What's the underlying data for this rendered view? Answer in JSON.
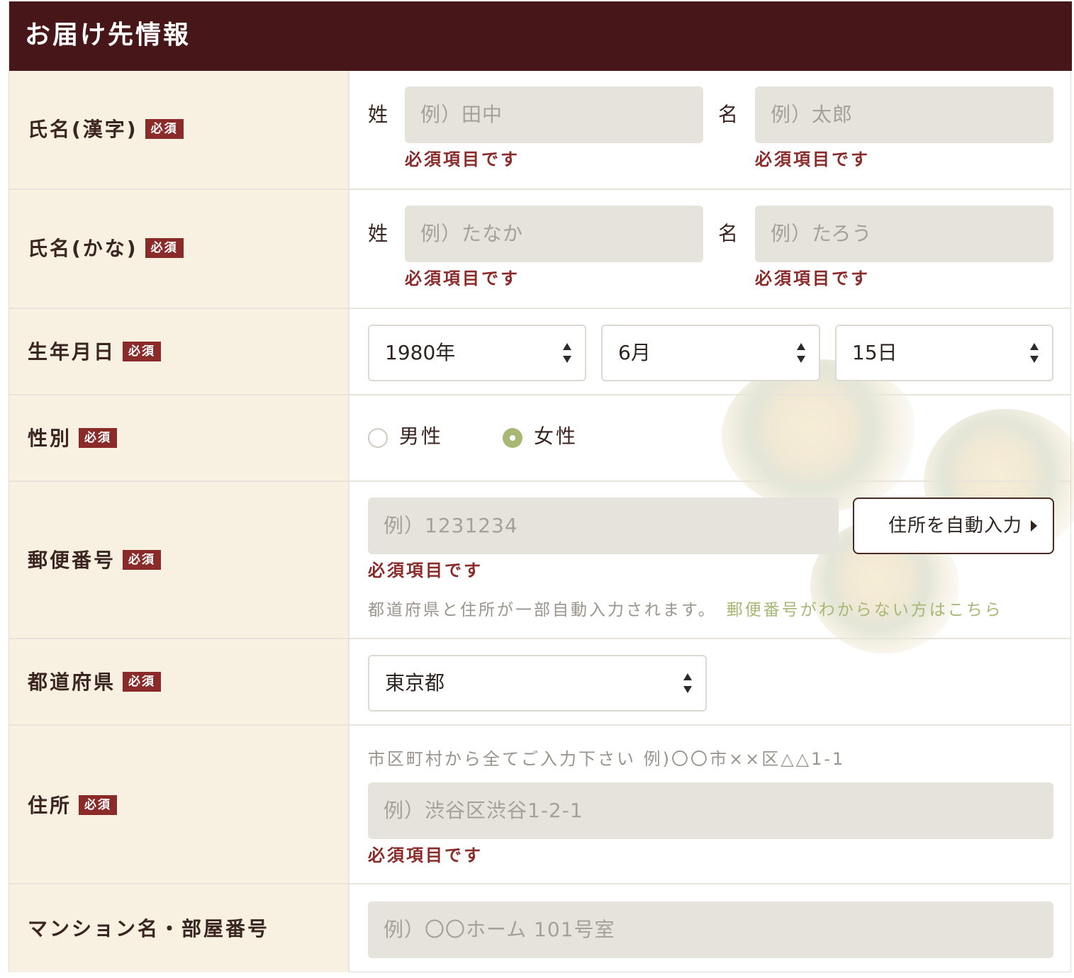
{
  "title": "お届け先情報",
  "required_badge": "必須",
  "error_text": "必須項目です",
  "name_kanji": {
    "label": "氏名(漢字)",
    "last_label": "姓",
    "first_label": "名",
    "last_placeholder": "例）田中",
    "first_placeholder": "例）太郎"
  },
  "name_kana": {
    "label": "氏名(かな)",
    "last_label": "姓",
    "first_label": "名",
    "last_placeholder": "例）たなか",
    "first_placeholder": "例）たろう"
  },
  "birthday": {
    "label": "生年月日",
    "year": "1980年",
    "month": "6月",
    "day": "15日"
  },
  "gender": {
    "label": "性別",
    "options": [
      "男性",
      "女性"
    ],
    "selected": "女性"
  },
  "postal": {
    "label": "郵便番号",
    "placeholder": "例）1231234",
    "autofill_button": "住所を自動入力",
    "note": "都道府県と住所が一部自動入力されます。",
    "link": "郵便番号がわからない方はこちら"
  },
  "prefecture": {
    "label": "都道府県",
    "value": "東京都"
  },
  "address": {
    "label": "住所",
    "hint": "市区町村から全てご入力下さい 例)〇〇市××区△△1-1",
    "placeholder": "例）渋谷区渋谷1-2-1"
  },
  "building": {
    "label": "マンション名・部屋番号",
    "placeholder": "例）〇〇ホーム 101号室"
  },
  "colors": {
    "header_bg": "#471619",
    "label_bg": "#f8f1e1",
    "required_badge": "#8a2b2a",
    "error": "#8a2b2a",
    "accent_green": "#a7b774",
    "input_bg": "#e6e3dd"
  }
}
